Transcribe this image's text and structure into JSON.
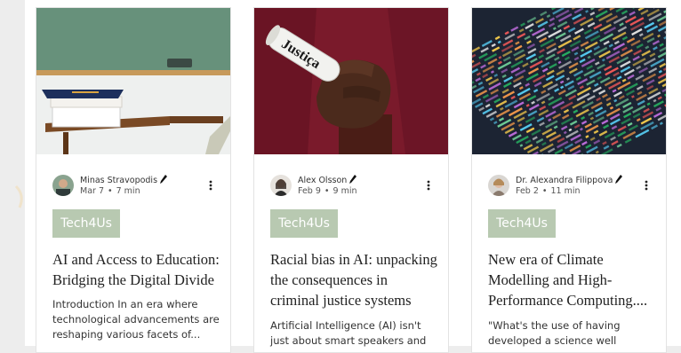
{
  "posts": [
    {
      "image_alt": "chalkboard and books",
      "author": "Minas Stravopodis",
      "date": "Mar 7",
      "read_time": "7 min",
      "tag": "Tech4Us",
      "title": "AI and Access to Education: Bridging the Digital Divide",
      "excerpt": "Introduction In an era where technological advancements are reshaping various facets of..."
    },
    {
      "image_alt": "hand holding rolled newspaper Justiça",
      "image_text": "Justiça",
      "author": "Alex Olsson",
      "date": "Feb 9",
      "read_time": "9 min",
      "tag": "Tech4Us",
      "title": "Racial bias in AI: unpacking the consequences in criminal justice systems",
      "excerpt": "Artificial Intelligence (AI) isn't just about smart speakers and"
    },
    {
      "image_alt": "colorful code on screen",
      "author": "Dr. Alexandra Filippova",
      "date": "Feb 2",
      "read_time": "11 min",
      "tag": "Tech4Us",
      "title": "New era of Climate Modelling and High-Performance Computing....",
      "excerpt": "\"What's the use of having developed a science well"
    }
  ],
  "icons": {
    "writer_badge": "pen-icon",
    "more_actions": "more-vertical-icon",
    "separator": "•"
  },
  "colors": {
    "tag_bg": "#b8c9b1",
    "card_border": "#e3e3e3"
  }
}
